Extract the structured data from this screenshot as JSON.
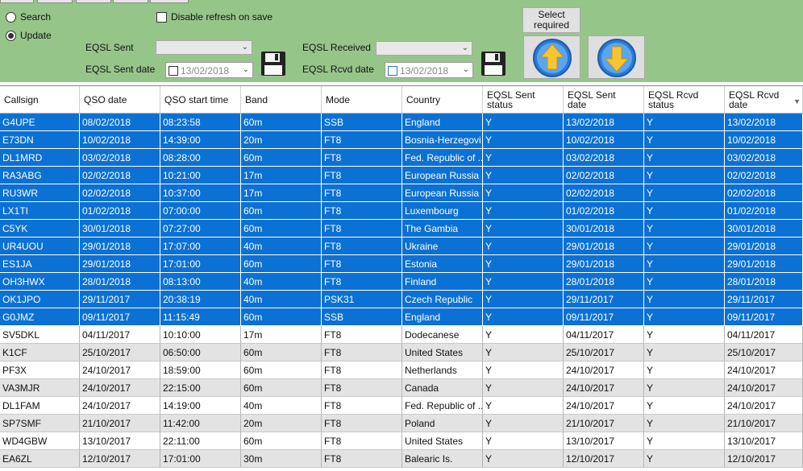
{
  "options": {
    "search_label": "Search",
    "update_label": "Update",
    "update_selected": true,
    "disable_refresh_label": "Disable refresh on save",
    "disable_refresh_checked": false
  },
  "eqsl_sent": {
    "label": "EQSL Sent",
    "value": "",
    "date_label": "EQSL Sent date",
    "date_value": "13/02/2018"
  },
  "eqsl_received": {
    "label": "EQSL Received",
    "value": "",
    "date_label": "EQSL Rcvd date",
    "date_value": "13/02/2018"
  },
  "select_required": {
    "line1": "Select",
    "line2": "required"
  },
  "icons": {
    "save": "floppy-disk-icon",
    "up": "arrow-up-icon",
    "down": "arrow-down-icon"
  },
  "colors": {
    "panel": "#96c58a",
    "selection": "#0c71d4",
    "alt_row": "#e3e3e3"
  },
  "table": {
    "columns": [
      {
        "line1": "Callsign",
        "line2": ""
      },
      {
        "line1": "QSO date",
        "line2": ""
      },
      {
        "line1": "QSO start time",
        "line2": ""
      },
      {
        "line1": "Band",
        "line2": ""
      },
      {
        "line1": "Mode",
        "line2": ""
      },
      {
        "line1": "Country",
        "line2": ""
      },
      {
        "line1": "EQSL Sent",
        "line2": "status"
      },
      {
        "line1": "EQSL Sent",
        "line2": "date"
      },
      {
        "line1": "EQSL Rcvd",
        "line2": "status"
      },
      {
        "line1": "EQSL Rcvd",
        "line2": "date"
      }
    ],
    "rows": [
      {
        "selected": true,
        "cells": [
          "G4UPE",
          "08/02/2018",
          "08:23:58",
          "60m",
          "SSB",
          "England",
          "Y",
          "13/02/2018",
          "Y",
          "13/02/2018"
        ]
      },
      {
        "selected": true,
        "cells": [
          "E73DN",
          "10/02/2018",
          "14:39:00",
          "20m",
          "FT8",
          "Bosnia-Herzegovi...",
          "Y",
          "10/02/2018",
          "Y",
          "10/02/2018"
        ]
      },
      {
        "selected": true,
        "cells": [
          "DL1MRD",
          "03/02/2018",
          "08:28:00",
          "60m",
          "FT8",
          "Fed. Republic of ...",
          "Y",
          "03/02/2018",
          "Y",
          "03/02/2018"
        ]
      },
      {
        "selected": true,
        "cells": [
          "RA3ABG",
          "02/02/2018",
          "10:21:00",
          "17m",
          "FT8",
          "European Russia",
          "Y",
          "02/02/2018",
          "Y",
          "02/02/2018"
        ]
      },
      {
        "selected": true,
        "cells": [
          "RU3WR",
          "02/02/2018",
          "10:37:00",
          "17m",
          "FT8",
          "European Russia",
          "Y",
          "02/02/2018",
          "Y",
          "02/02/2018"
        ]
      },
      {
        "selected": true,
        "cells": [
          "LX1TI",
          "01/02/2018",
          "07:00:00",
          "60m",
          "FT8",
          "Luxembourg",
          "Y",
          "01/02/2018",
          "Y",
          "01/02/2018"
        ]
      },
      {
        "selected": true,
        "cells": [
          "C5YK",
          "30/01/2018",
          "07:27:00",
          "60m",
          "FT8",
          "The Gambia",
          "Y",
          "30/01/2018",
          "Y",
          "30/01/2018"
        ]
      },
      {
        "selected": true,
        "cells": [
          "UR4UOU",
          "29/01/2018",
          "17:07:00",
          "40m",
          "FT8",
          "Ukraine",
          "Y",
          "29/01/2018",
          "Y",
          "29/01/2018"
        ]
      },
      {
        "selected": true,
        "cells": [
          "ES1JA",
          "29/01/2018",
          "17:01:00",
          "60m",
          "FT8",
          "Estonia",
          "Y",
          "29/01/2018",
          "Y",
          "29/01/2018"
        ]
      },
      {
        "selected": true,
        "cells": [
          "OH3HWX",
          "28/01/2018",
          "08:13:00",
          "40m",
          "FT8",
          "Finland",
          "Y",
          "28/01/2018",
          "Y",
          "28/01/2018"
        ]
      },
      {
        "selected": true,
        "cells": [
          "OK1JPO",
          "29/11/2017",
          "20:38:19",
          "40m",
          "PSK31",
          "Czech Republic",
          "Y",
          "29/11/2017",
          "Y",
          "29/11/2017"
        ]
      },
      {
        "selected": true,
        "cells": [
          "G0JMZ",
          "09/11/2017",
          "11:15:49",
          "60m",
          "SSB",
          "England",
          "Y",
          "09/11/2017",
          "Y",
          "09/11/2017"
        ]
      },
      {
        "selected": false,
        "cells": [
          "SV5DKL",
          "04/11/2017",
          "10:10:00",
          "17m",
          "FT8",
          "Dodecanese",
          "Y",
          "04/11/2017",
          "Y",
          "04/11/2017"
        ]
      },
      {
        "selected": false,
        "cells": [
          "K1CF",
          "25/10/2017",
          "06:50:00",
          "60m",
          "FT8",
          "United States",
          "Y",
          "25/10/2017",
          "Y",
          "25/10/2017"
        ]
      },
      {
        "selected": false,
        "cells": [
          "PF3X",
          "24/10/2017",
          "18:59:00",
          "60m",
          "FT8",
          "Netherlands",
          "Y",
          "24/10/2017",
          "Y",
          "24/10/2017"
        ]
      },
      {
        "selected": false,
        "cells": [
          "VA3MJR",
          "24/10/2017",
          "22:15:00",
          "60m",
          "FT8",
          "Canada",
          "Y",
          "24/10/2017",
          "Y",
          "24/10/2017"
        ]
      },
      {
        "selected": false,
        "cells": [
          "DL1FAM",
          "24/10/2017",
          "14:19:00",
          "40m",
          "FT8",
          "Fed. Republic of ...",
          "Y",
          "24/10/2017",
          "Y",
          "24/10/2017"
        ]
      },
      {
        "selected": false,
        "cells": [
          "SP7SMF",
          "21/10/2017",
          "11:42:00",
          "20m",
          "FT8",
          "Poland",
          "Y",
          "21/10/2017",
          "Y",
          "21/10/2017"
        ]
      },
      {
        "selected": false,
        "cells": [
          "WD4GBW",
          "13/10/2017",
          "22:11:00",
          "60m",
          "FT8",
          "United States",
          "Y",
          "13/10/2017",
          "Y",
          "13/10/2017"
        ]
      },
      {
        "selected": false,
        "cells": [
          "EA6ZL",
          "12/10/2017",
          "17:01:00",
          "30m",
          "FT8",
          "Balearic Is.",
          "Y",
          "12/10/2017",
          "Y",
          "12/10/2017"
        ]
      }
    ]
  }
}
